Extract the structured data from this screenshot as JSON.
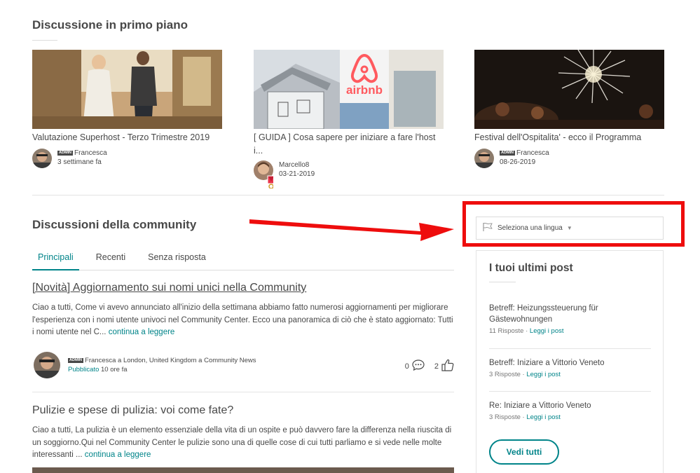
{
  "featured": {
    "title": "Discussione in primo piano",
    "cards": [
      {
        "title": "Valutazione Superhost - Terzo Trimestre 2019",
        "title_cont": "",
        "author": "Francesca",
        "badge": "ADMIN",
        "time": "3 settimane fa"
      },
      {
        "title": "[ GUIDA ] Cosa sapere per iniziare a fare l'host",
        "title_cont": "i...",
        "author": "Marcello8",
        "badge": "",
        "time": "03-21-2019",
        "image_logo_text": "airbnb"
      },
      {
        "title": "Festival dell'Ospitalita' - ecco il Programma",
        "title_cont": "",
        "author": "Francesca",
        "badge": "ADMIN",
        "time": "08-26-2019"
      }
    ]
  },
  "community": {
    "title": "Discussioni della community",
    "tabs": [
      "Principali",
      "Recenti",
      "Senza risposta"
    ],
    "active_tab": "Principali",
    "posts": [
      {
        "title": "[Novità] Aggiornamento sui nomi unici nella Community",
        "excerpt": "Ciao a tutti, Come vi avevo annunciato all'inizio della settimana abbiamo fatto numerosi aggiornamenti per migliorare l'esperienza con i nomi utente univoci nel Community Center. Ecco una panoramica di ciò che è stato aggiornato: Tutti i nomi utente nel C...",
        "more": "continua a leggere",
        "badge": "ADMIN",
        "author_line": "Francesca a London, United Kingdom a Community News",
        "status": "Pubblicato",
        "time": "10 ore fa",
        "comments": "0",
        "likes": "2"
      },
      {
        "title": "Pulizie e spese di pulizia: voi come fate?",
        "excerpt": "Ciao a tutti, La pulizia è un elemento essenziale della vita di un ospite e può davvero fare la differenza nella riuscita di un soggiorno.Qui nel Community Center le pulizie sono una di quelle cose di cui tutti parliamo e si vede nelle molte interessanti ...",
        "more": "continua a leggere"
      }
    ]
  },
  "language": {
    "placeholder": "Seleziona una lingua"
  },
  "recent_posts": {
    "title": "I tuoi ultimi post",
    "items": [
      {
        "title": "Betreff: Heizungssteuerung für Gästewohnungen",
        "replies": "11 Risposte",
        "link": "Leggi i post"
      },
      {
        "title": "Betreff: Iniziare a Vittorio Veneto",
        "replies": "3 Risposte",
        "link": "Leggi i post"
      },
      {
        "title": "Re: Iniziare a Vittorio Veneto",
        "replies": "3 Risposte",
        "link": "Leggi i post"
      }
    ],
    "button": "Vedi tutti"
  },
  "colors": {
    "accent": "#008489",
    "annotation": "#ee0d0d",
    "text": "#484848"
  }
}
